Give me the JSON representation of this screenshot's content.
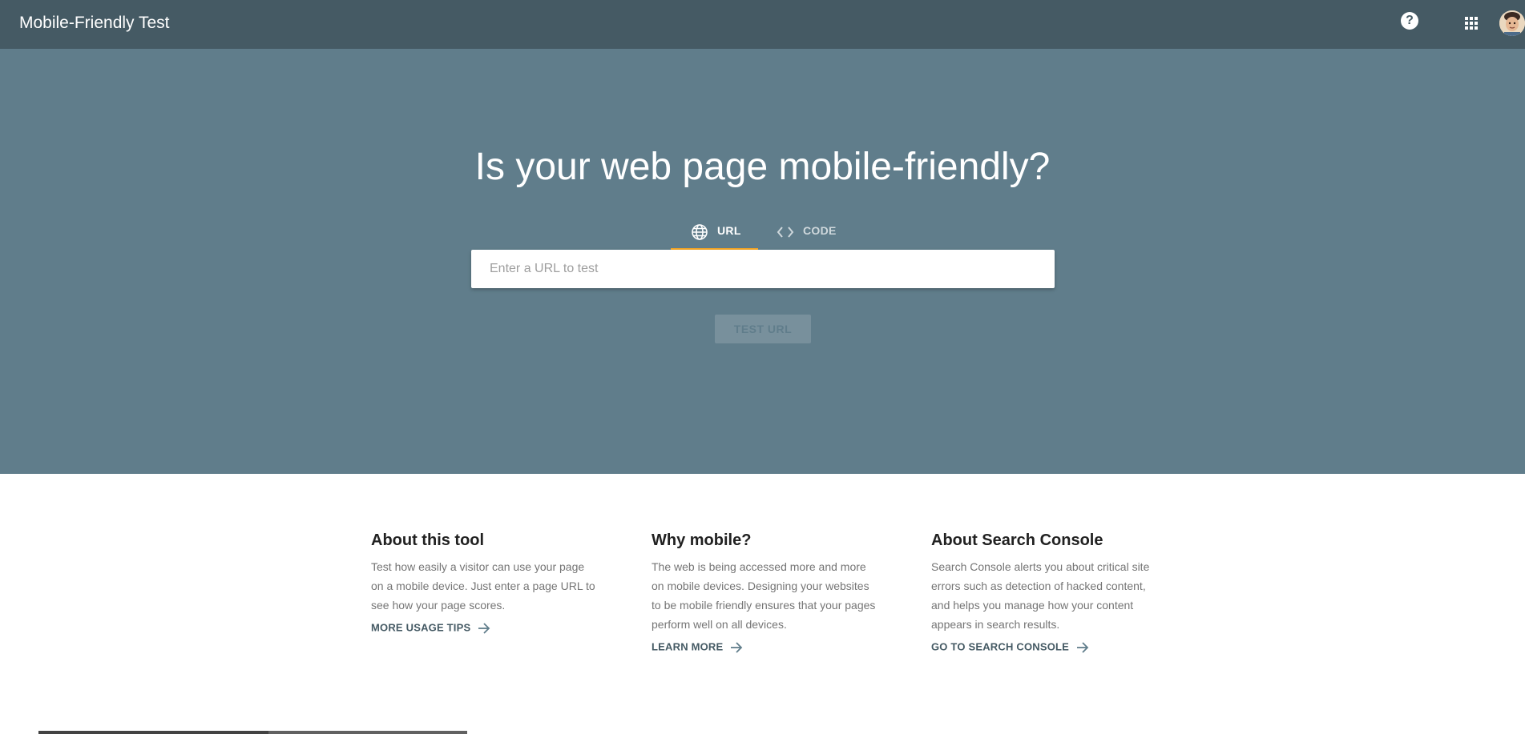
{
  "header": {
    "title": "Mobile-Friendly Test",
    "help_glyph": "?",
    "icons": [
      "help-icon",
      "apps-grid-icon",
      "user-avatar"
    ]
  },
  "hero": {
    "headline": "Is your web page mobile-friendly?",
    "tabs": [
      {
        "label": "URL",
        "icon": "globe-icon",
        "active": true
      },
      {
        "label": "CODE",
        "icon": "code-brackets-icon",
        "active": false
      }
    ],
    "url_input": {
      "placeholder": "Enter a URL to test",
      "value": ""
    },
    "test_button": {
      "label": "TEST URL",
      "enabled": false
    }
  },
  "info": [
    {
      "title": "About this tool",
      "text": "Test how easily a visitor can use your page on a mobile device. Just enter a page URL to see how your page scores.",
      "link": "MORE USAGE TIPS"
    },
    {
      "title": "Why mobile?",
      "text": "The web is being accessed more and more on mobile devices. Designing your websites to be mobile friendly ensures that your pages perform well on all devices.",
      "link": "LEARN MORE"
    },
    {
      "title": "About Search Console",
      "text": "Search Console alerts you about critical site errors such as detection of hacked content, and helps you manage how your content appears in search results.",
      "link": "GO TO SEARCH CONSOLE"
    }
  ],
  "colors": {
    "header_bg": "#455a64",
    "hero_bg": "#607d8b",
    "tab_underline": "#f5a623",
    "button_disabled_bg": "#78909c"
  }
}
